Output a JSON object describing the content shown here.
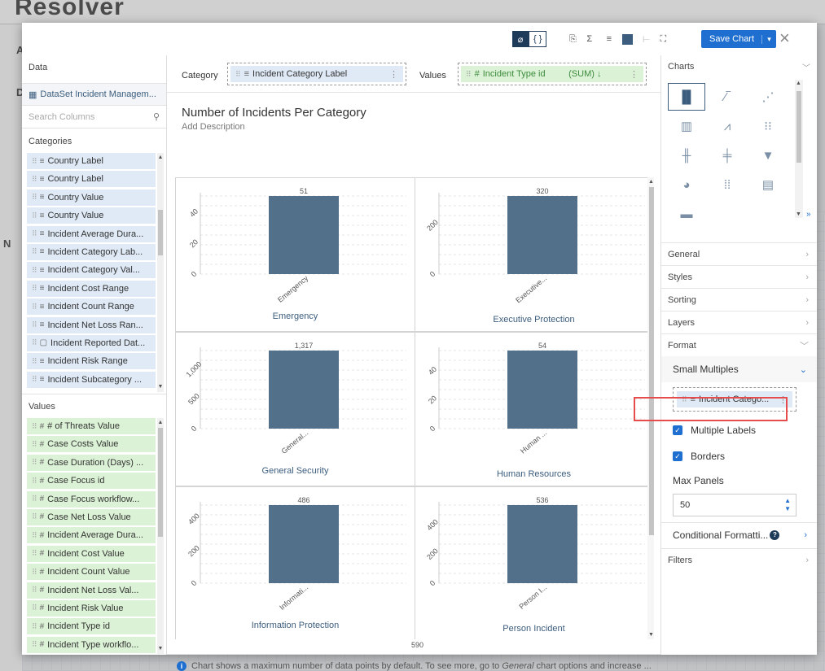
{
  "background": {
    "logo": "Resolver",
    "letters": [
      "A",
      "D",
      "N"
    ]
  },
  "toolbar": {
    "save_label": "Save Chart",
    "save_caret": "▾",
    "close": "×"
  },
  "left": {
    "title": "Data",
    "dataset": "DataSet Incident Managem...",
    "search_placeholder": "Search Columns",
    "categories_title": "Categories",
    "categories": [
      {
        "label": "Country Label",
        "icon": "≡"
      },
      {
        "label": "Country Label",
        "icon": "≡"
      },
      {
        "label": "Country Value",
        "icon": "≡"
      },
      {
        "label": "Country Value",
        "icon": "≡"
      },
      {
        "label": "Incident Average Dura...",
        "icon": "≡"
      },
      {
        "label": "Incident Category Lab...",
        "icon": "≡"
      },
      {
        "label": "Incident Category Val...",
        "icon": "≡"
      },
      {
        "label": "Incident Cost Range",
        "icon": "≡"
      },
      {
        "label": "Incident Count Range",
        "icon": "≡"
      },
      {
        "label": "Incident Net Loss Ran...",
        "icon": "≡"
      },
      {
        "label": "Incident Reported Dat...",
        "icon": "▢"
      },
      {
        "label": "Incident Risk Range",
        "icon": "≡"
      },
      {
        "label": "Incident Subcategory ...",
        "icon": "≡"
      }
    ],
    "values_title": "Values",
    "values": [
      {
        "label": "# of Threats Value",
        "icon": "#"
      },
      {
        "label": "Case Costs Value",
        "icon": "#"
      },
      {
        "label": "Case Duration (Days) ...",
        "icon": "#"
      },
      {
        "label": "Case Focus id",
        "icon": "#"
      },
      {
        "label": "Case Focus workflow...",
        "icon": "#"
      },
      {
        "label": "Case Net Loss Value",
        "icon": "#"
      },
      {
        "label": "Incident Average Dura...",
        "icon": "#"
      },
      {
        "label": "Incident Cost Value",
        "icon": "#"
      },
      {
        "label": "Incident Count Value",
        "icon": "#"
      },
      {
        "label": "Incident Net Loss Val...",
        "icon": "#"
      },
      {
        "label": "Incident Risk Value",
        "icon": "#"
      },
      {
        "label": "Incident Type id",
        "icon": "#"
      },
      {
        "label": "Incident Type workflo...",
        "icon": "#"
      }
    ]
  },
  "shelf": {
    "category_label": "Category",
    "category_field": "Incident Category Label",
    "values_label": "Values",
    "values_field": "Incident Type id",
    "values_agg": "(SUM) ↓"
  },
  "chart": {
    "title": "Number of Incidents Per Category",
    "description": "Add Description",
    "more_value": "590",
    "notice_pre": "Chart shows a maximum number of data points by default. To see more, go to ",
    "notice_em": "General",
    "notice_post": " chart options and increase ..."
  },
  "chart_data": {
    "type": "bar",
    "bar_color": "#53708b",
    "panels": [
      {
        "title": "Emergency",
        "category_tick": "Emergency",
        "value": 51,
        "value_label": "51",
        "ylim": [
          0,
          51
        ],
        "ticks": [
          0,
          20,
          40
        ]
      },
      {
        "title": "Executive Protection",
        "category_tick": "Executive...",
        "value": 320,
        "value_label": "320",
        "ylim": [
          0,
          320
        ],
        "ticks": [
          0,
          200
        ]
      },
      {
        "title": "General Security",
        "category_tick": "General...",
        "value": 1317,
        "value_label": "1,317",
        "ylim": [
          0,
          1317
        ],
        "ticks": [
          0,
          500,
          1000
        ],
        "tick_labels": [
          "0",
          "500",
          "1,000"
        ]
      },
      {
        "title": "Human Resources",
        "category_tick": "Human ...",
        "value": 54,
        "value_label": "54",
        "ylim": [
          0,
          54
        ],
        "ticks": [
          0,
          20,
          40
        ]
      },
      {
        "title": "Information Protection",
        "category_tick": "Informati...",
        "value": 486,
        "value_label": "486",
        "ylim": [
          0,
          486
        ],
        "ticks": [
          0,
          200,
          400
        ]
      },
      {
        "title": "Person Incident",
        "category_tick": "Person I...",
        "value": 536,
        "value_label": "536",
        "ylim": [
          0,
          536
        ],
        "ticks": [
          0,
          200,
          400
        ]
      }
    ]
  },
  "right": {
    "charts_title": "Charts",
    "sections": [
      "General",
      "Styles",
      "Sorting",
      "Layers",
      "Format"
    ],
    "small_multiples": "Small Multiples",
    "sm_field": "Incident Catego...",
    "multiple_labels": "Multiple Labels",
    "borders": "Borders",
    "max_panels_label": "Max Panels",
    "max_panels_value": "50",
    "conditional_formatting": "Conditional Formatti...",
    "filters": "Filters"
  }
}
